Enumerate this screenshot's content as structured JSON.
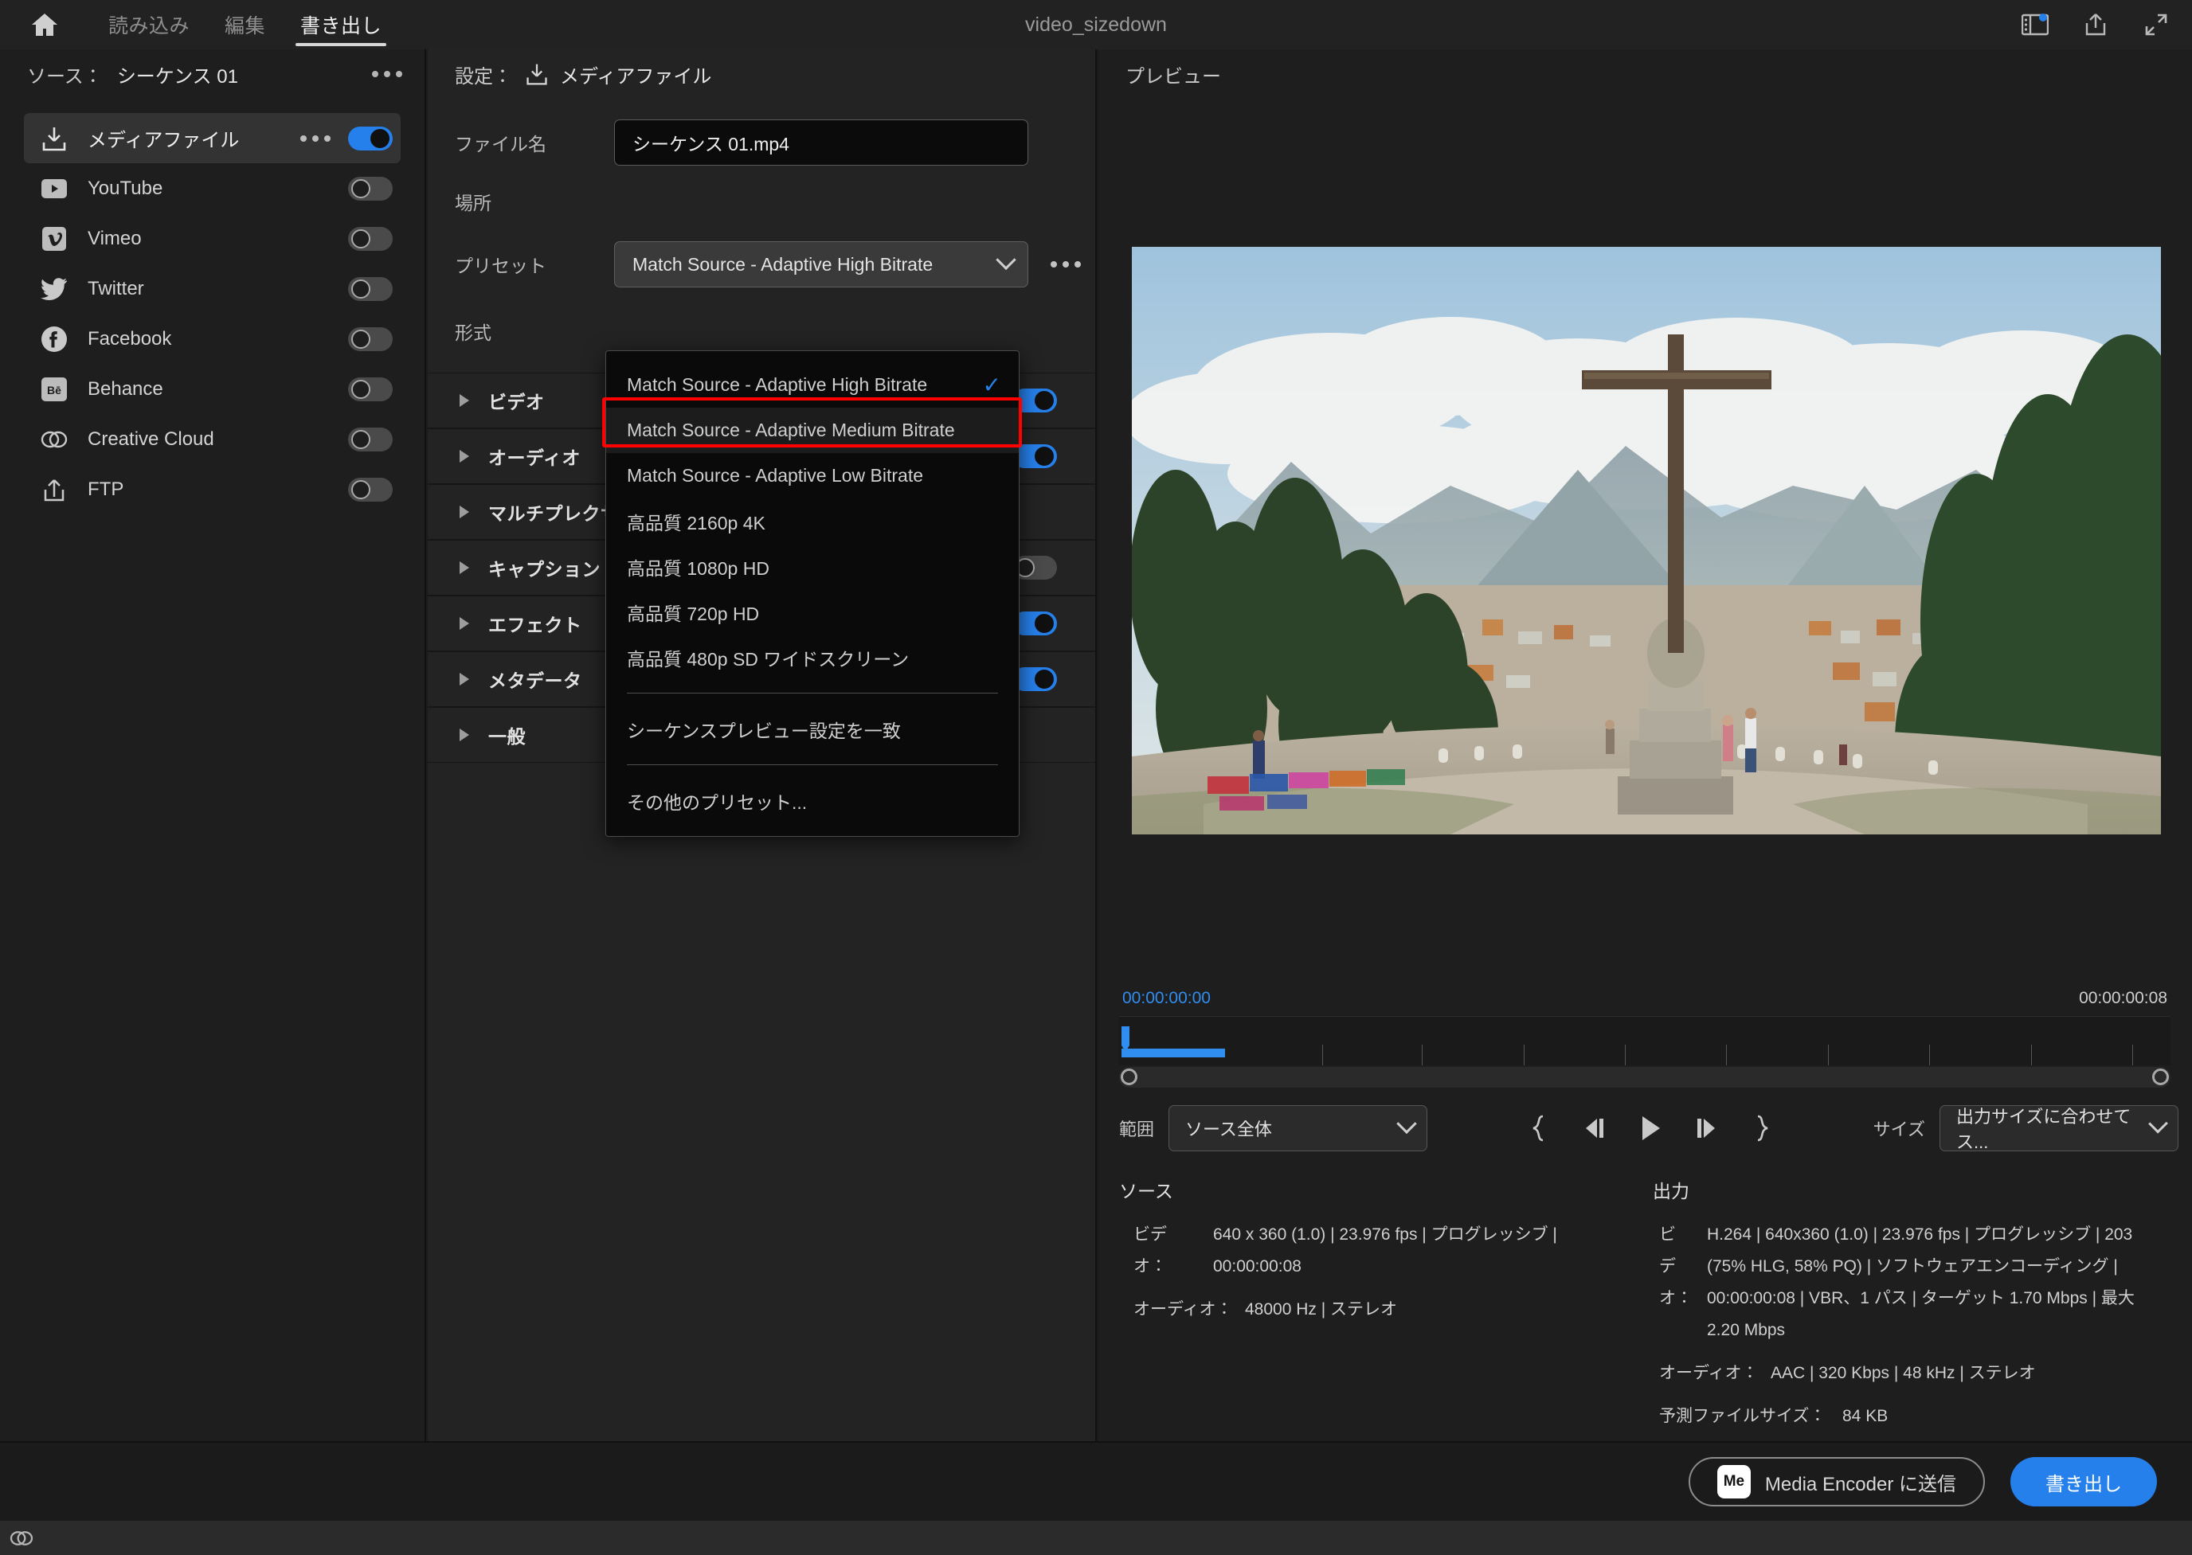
{
  "window": {
    "title": "video_sizedown"
  },
  "topnav": {
    "home_icon": "home-icon",
    "tabs": [
      {
        "label": "読み込み",
        "active": false
      },
      {
        "label": "編集",
        "active": false
      },
      {
        "label": "書き出し",
        "active": true
      }
    ],
    "right_icons": [
      {
        "name": "workspace-icon",
        "badge": true
      },
      {
        "name": "share-icon",
        "badge": false
      },
      {
        "name": "fullscreen-icon",
        "badge": false
      }
    ]
  },
  "sidebar": {
    "header_label": "ソース：",
    "header_value": "シーケンス 01",
    "more_icon": "ellipsis-icon",
    "items": [
      {
        "label": "メディアファイル",
        "icon": "media-file-icon",
        "toggle": "on",
        "selected": true,
        "has_dots": true
      },
      {
        "label": "YouTube",
        "icon": "youtube-icon",
        "toggle": "off",
        "selected": false,
        "has_dots": false
      },
      {
        "label": "Vimeo",
        "icon": "vimeo-icon",
        "toggle": "off",
        "selected": false,
        "has_dots": false
      },
      {
        "label": "Twitter",
        "icon": "twitter-icon",
        "toggle": "off",
        "selected": false,
        "has_dots": false
      },
      {
        "label": "Facebook",
        "icon": "facebook-icon",
        "toggle": "off",
        "selected": false,
        "has_dots": false
      },
      {
        "label": "Behance",
        "icon": "behance-icon",
        "toggle": "off",
        "selected": false,
        "has_dots": false
      },
      {
        "label": "Creative Cloud",
        "icon": "creative-cloud-icon",
        "toggle": "off",
        "selected": false,
        "has_dots": false
      },
      {
        "label": "FTP",
        "icon": "ftp-icon",
        "toggle": "off",
        "selected": false,
        "has_dots": false
      }
    ]
  },
  "settings": {
    "header_label": "設定：",
    "header_icon": "media-file-icon",
    "header_value": "メディアファイル",
    "filename_label": "ファイル名",
    "filename_value": "シーケンス 01.mp4",
    "location_label": "場所",
    "location_value": "",
    "preset_label": "プリセット",
    "preset_value": "Match Source - Adaptive High Bitrate",
    "preset_more_icon": "ellipsis-icon",
    "format_label": "形式",
    "sections": [
      {
        "label": "ビデオ",
        "toggle": "on"
      },
      {
        "label": "オーディオ",
        "toggle": "on"
      },
      {
        "label": "マルチプレクサー",
        "toggle": "none"
      },
      {
        "label": "キャプション",
        "toggle": "off"
      },
      {
        "label": "エフェクト",
        "toggle": "on"
      },
      {
        "label": "メタデータ",
        "toggle": "on"
      },
      {
        "label": "一般",
        "toggle": "none"
      }
    ]
  },
  "preset_dropdown": {
    "open": true,
    "items": [
      {
        "label": "Match Source - Adaptive High Bitrate",
        "checked": true,
        "highlighted": false,
        "separator_after": false
      },
      {
        "label": "Match Source - Adaptive Medium Bitrate",
        "checked": false,
        "highlighted": true,
        "separator_after": false
      },
      {
        "label": "Match Source - Adaptive Low Bitrate",
        "checked": false,
        "highlighted": false,
        "separator_after": false
      },
      {
        "label": "高品質 2160p 4K",
        "checked": false,
        "highlighted": false,
        "separator_after": false
      },
      {
        "label": "高品質 1080p HD",
        "checked": false,
        "highlighted": false,
        "separator_after": false
      },
      {
        "label": "高品質 720p HD",
        "checked": false,
        "highlighted": false,
        "separator_after": false
      },
      {
        "label": "高品質 480p SD ワイドスクリーン",
        "checked": false,
        "highlighted": false,
        "separator_after": true
      },
      {
        "label": "シーケンスプレビュー設定を一致",
        "checked": false,
        "highlighted": false,
        "separator_after": true
      },
      {
        "label": "その他のプリセット...",
        "checked": false,
        "highlighted": false,
        "separator_after": false
      }
    ],
    "annotation_color": "#ff0000",
    "annotated_item": "Match Source - Adaptive Medium Bitrate"
  },
  "preview": {
    "header": "プレビュー",
    "timeline": {
      "start_time": "00:00:00:00",
      "end_time": "00:00:00:08"
    },
    "range_label": "範囲",
    "range_value": "ソース全体",
    "size_label": "サイズ",
    "size_value": "出力サイズに合わせてス...",
    "transport_icons": [
      "mark-in-icon",
      "step-back-icon",
      "play-icon",
      "step-forward-icon",
      "mark-out-icon"
    ]
  },
  "source_info": {
    "heading": "ソース",
    "video_key": "ビデオ：",
    "video_key_l1": "ビデ",
    "video_key_l2": "オ：",
    "video_line1": "640 x 360 (1.0) | 23.976 fps | プログレッシブ |",
    "video_line2": "00:00:00:08",
    "audio_key": "オーディオ：",
    "audio_value": "48000 Hz | ステレオ"
  },
  "output_info": {
    "heading": "出力",
    "video_key_l1": "ビ",
    "video_key_l2": "デ",
    "video_key_l3": "オ：",
    "video_line1": "H.264 | 640x360 (1.0) | 23.976 fps | プログレッシブ | 203",
    "video_line2": "(75% HLG, 58% PQ) | ソフトウェアエンコーディング |",
    "video_line3": "00:00:00:08 | VBR、1 パス | ターゲット 1.70 Mbps | 最大",
    "video_line4": "2.20 Mbps",
    "audio_key": "オーディオ：",
    "audio_value": "AAC | 320 Kbps | 48 kHz | ステレオ",
    "filesize_key": "予測ファイルサイズ：",
    "filesize_value": "84 KB"
  },
  "footer": {
    "send_to_me_label": "Media Encoder に送信",
    "me_badge": "Me",
    "export_label": "書き出し"
  },
  "statusbar": {
    "icon": "creative-cloud-icon"
  },
  "colors": {
    "accent": "#2680eb",
    "annotation": "#ff0000",
    "panel_bg": "#232323",
    "sidebar_bg": "#1e1e1e",
    "topbar_bg": "#222222"
  }
}
